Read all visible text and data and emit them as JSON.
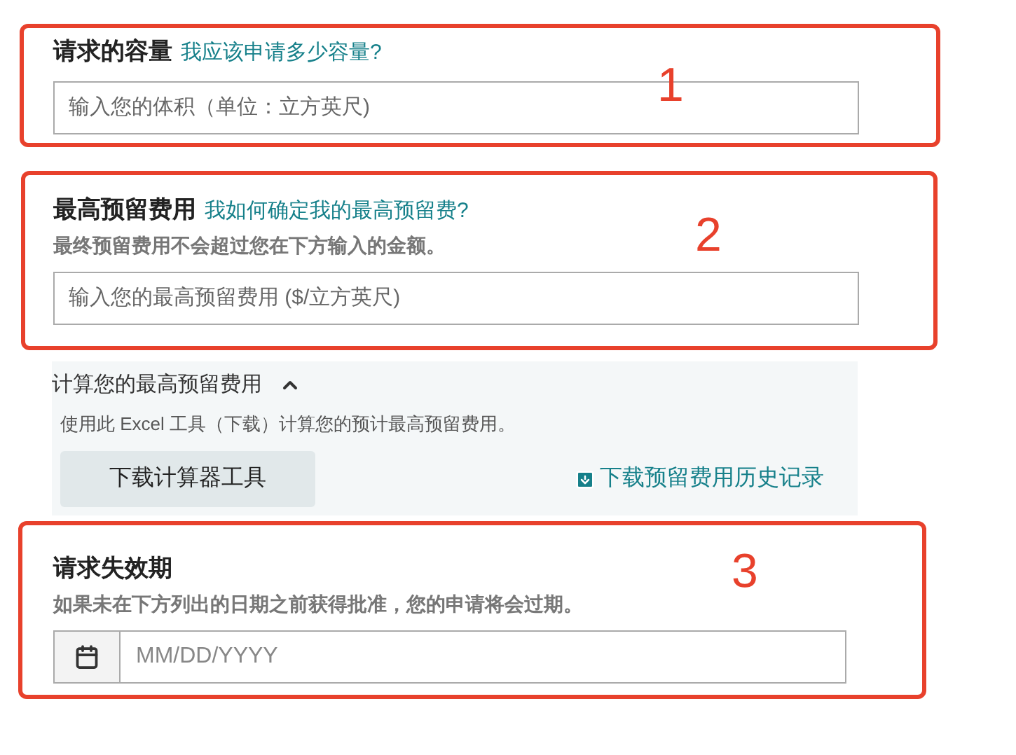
{
  "capacity": {
    "marker": "1",
    "label": "请求的容量",
    "help_link": "我应该申请多少容量?",
    "placeholder": "输入您的体积（单位：立方英尺)"
  },
  "max_fee": {
    "marker": "2",
    "label": "最高预留费用",
    "help_link": "我如何确定我的最高预留费?",
    "hint": "最终预留费用不会超过您在下方输入的金额。",
    "placeholder": "输入您的最高预留费用 ($/立方英尺)"
  },
  "calculator": {
    "title": "计算您的最高预留费用",
    "expanded": true,
    "description": "使用此 Excel 工具（下载）计算您的预计最高预留费用。",
    "button": "下载计算器工具",
    "history_link": "下载预留费用历史记录"
  },
  "expiration": {
    "marker": "3",
    "label": "请求失效期",
    "hint": "如果未在下方列出的日期之前获得批准，您的申请将会过期。",
    "placeholder": "MM/DD/YYYY"
  }
}
